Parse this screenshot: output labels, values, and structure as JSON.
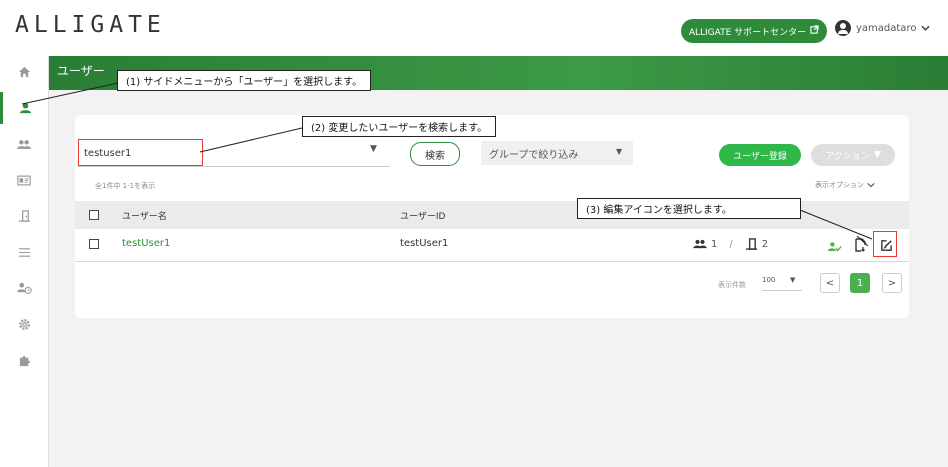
{
  "header": {
    "logo": "ALLIGATE",
    "support_label": "ALLIGATE サポートセンター",
    "username": "yamadataro"
  },
  "sidebar": {
    "items": [
      {
        "icon": "home-icon"
      },
      {
        "icon": "user-icon",
        "active": true
      },
      {
        "icon": "group-icon"
      },
      {
        "icon": "id-card-icon"
      },
      {
        "icon": "door-icon"
      },
      {
        "icon": "list-icon"
      },
      {
        "icon": "user-clock-icon"
      },
      {
        "icon": "gear-icon"
      },
      {
        "icon": "puzzle-icon"
      }
    ]
  },
  "page": {
    "title": "ユーザー"
  },
  "toolbar": {
    "search_value": "testuser1",
    "search_button": "検索",
    "group_filter": "グループで絞り込み",
    "register_button": "ユーザー登録",
    "action_button": "アクション"
  },
  "list": {
    "count_text": "全1件中 1-1を表示",
    "display_options": "表示オプション",
    "columns": [
      "ユーザー名",
      "ユーザーID"
    ],
    "rows": [
      {
        "username": "testUser1",
        "user_id": "testUser1",
        "groups": "1",
        "doors": "2"
      }
    ],
    "separator": "/"
  },
  "pagination": {
    "label": "表示件数",
    "per_page": "100",
    "current_page": "1",
    "prev": "<",
    "next": ">"
  },
  "callouts": {
    "step1": "(1) サイドメニューから「ユーザー」を選択します。",
    "step2": "(2) 変更したいユーザーを検索します。",
    "step3": "(3) 編集アイコンを選択します。"
  },
  "colors": {
    "accent": "#2e8b3a",
    "register": "#2eb84a",
    "highlight": "#e53935"
  }
}
